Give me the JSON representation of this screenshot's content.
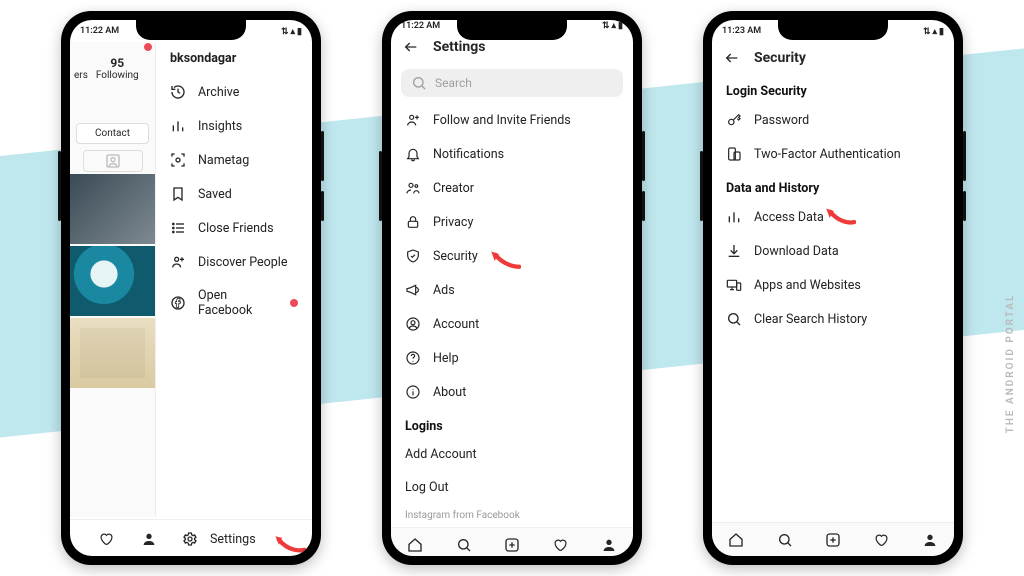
{
  "watermark": "THE ANDROID PORTAL",
  "phone1": {
    "time": "11:22 AM",
    "username": "bksondagar",
    "following_count": "95",
    "following_label": "Following",
    "ers_label": "ers",
    "contact_button": "Contact",
    "menu": {
      "archive": "Archive",
      "insights": "Insights",
      "nametag": "Nametag",
      "saved": "Saved",
      "close_friends": "Close Friends",
      "discover_people": "Discover People",
      "open_facebook": "Open Facebook"
    },
    "settings_label": "Settings"
  },
  "phone2": {
    "time": "11:22 AM",
    "title": "Settings",
    "search_placeholder": "Search",
    "items": {
      "follow_invite": "Follow and Invite Friends",
      "notifications": "Notifications",
      "creator": "Creator",
      "privacy": "Privacy",
      "security": "Security",
      "ads": "Ads",
      "account": "Account",
      "help": "Help",
      "about": "About"
    },
    "logins_header": "Logins",
    "add_account": "Add Account",
    "log_out": "Log Out",
    "footer": "Instagram from Facebook"
  },
  "phone3": {
    "time": "11:23 AM",
    "title": "Security",
    "login_security_header": "Login Security",
    "password": "Password",
    "two_factor": "Two-Factor Authentication",
    "data_history_header": "Data and History",
    "access_data": "Access Data",
    "download_data": "Download Data",
    "apps_websites": "Apps and Websites",
    "clear_search": "Clear Search History"
  }
}
